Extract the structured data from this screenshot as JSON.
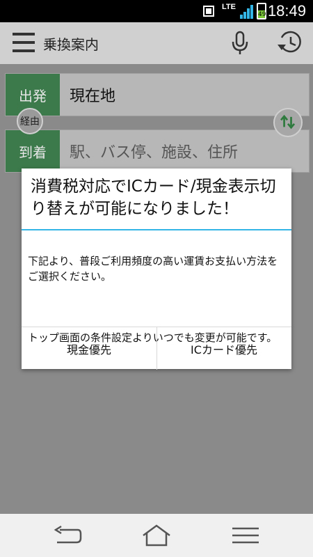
{
  "status_bar": {
    "network": "LTE",
    "battery_level": "49",
    "time": "18:49"
  },
  "app_bar": {
    "title": "乗換案内",
    "icons": [
      "menu-icon",
      "microphone-icon",
      "history-icon"
    ]
  },
  "search": {
    "departure_label": "出発",
    "departure_value": "現在地",
    "via_label": "経由",
    "arrival_label": "到着",
    "arrival_placeholder": "駅、バス停、施設、住所"
  },
  "dialog": {
    "title": "消費税対応でICカード/現金表示切り替えが可能になりました！",
    "body_line1": "下記より、普段ご利用頻度の高い運賃お支払い方法をご選択ください。",
    "body_line2": "トップ画面の条件設定よりいつでも変更が可能です。",
    "buttons": [
      "現金優先",
      "ICカード優先"
    ]
  },
  "colors": {
    "accent_green": "#3c7a4b",
    "divider_blue": "#33b5e5"
  },
  "nav_bar": {
    "icons": [
      "back-icon",
      "home-icon",
      "recent-apps-icon"
    ]
  }
}
